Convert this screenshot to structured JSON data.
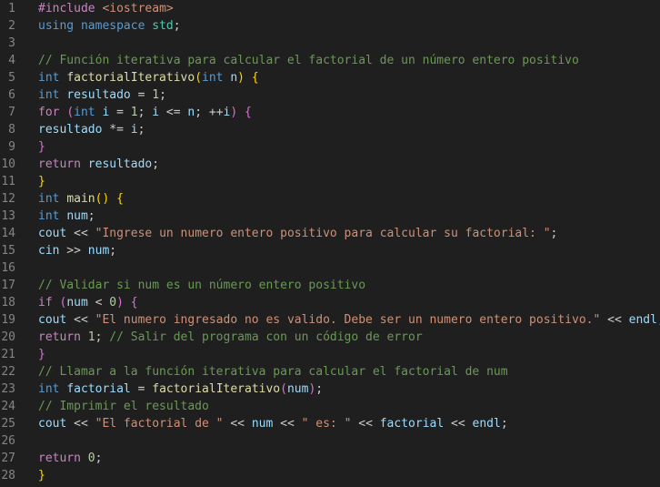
{
  "editor": {
    "language": "C++",
    "lines": [
      {
        "n": "1",
        "tokens": [
          {
            "t": "#include",
            "c": "c"
          },
          {
            "t": " ",
            "c": "p"
          },
          {
            "t": "<iostream>",
            "c": "inc"
          }
        ]
      },
      {
        "n": "2",
        "tokens": [
          {
            "t": "using",
            "c": "k"
          },
          {
            "t": " ",
            "c": "p"
          },
          {
            "t": "namespace",
            "c": "k"
          },
          {
            "t": " ",
            "c": "p"
          },
          {
            "t": "std",
            "c": "t"
          },
          {
            "t": ";",
            "c": "p"
          }
        ]
      },
      {
        "n": "3",
        "tokens": []
      },
      {
        "n": "4",
        "tokens": [
          {
            "t": "// Función iterativa para calcular el factorial de un número entero positivo",
            "c": "cm"
          }
        ]
      },
      {
        "n": "5",
        "tokens": [
          {
            "t": "int",
            "c": "k"
          },
          {
            "t": " ",
            "c": "p"
          },
          {
            "t": "factorialIterativo",
            "c": "f"
          },
          {
            "t": "(",
            "c": "b1"
          },
          {
            "t": "int",
            "c": "k"
          },
          {
            "t": " ",
            "c": "p"
          },
          {
            "t": "n",
            "c": "v"
          },
          {
            "t": ")",
            "c": "b1"
          },
          {
            "t": " ",
            "c": "p"
          },
          {
            "t": "{",
            "c": "b1"
          }
        ]
      },
      {
        "n": "6",
        "tokens": [
          {
            "t": "int",
            "c": "k"
          },
          {
            "t": " ",
            "c": "p"
          },
          {
            "t": "resultado",
            "c": "v"
          },
          {
            "t": " = ",
            "c": "p"
          },
          {
            "t": "1",
            "c": "n"
          },
          {
            "t": ";",
            "c": "p"
          }
        ]
      },
      {
        "n": "7",
        "tokens": [
          {
            "t": "for",
            "c": "c"
          },
          {
            "t": " ",
            "c": "p"
          },
          {
            "t": "(",
            "c": "b2"
          },
          {
            "t": "int",
            "c": "k"
          },
          {
            "t": " ",
            "c": "p"
          },
          {
            "t": "i",
            "c": "v"
          },
          {
            "t": " = ",
            "c": "p"
          },
          {
            "t": "1",
            "c": "n"
          },
          {
            "t": "; ",
            "c": "p"
          },
          {
            "t": "i",
            "c": "v"
          },
          {
            "t": " <= ",
            "c": "p"
          },
          {
            "t": "n",
            "c": "v"
          },
          {
            "t": "; ++",
            "c": "p"
          },
          {
            "t": "i",
            "c": "v"
          },
          {
            "t": ")",
            "c": "b2"
          },
          {
            "t": " ",
            "c": "p"
          },
          {
            "t": "{",
            "c": "b2"
          }
        ]
      },
      {
        "n": "8",
        "tokens": [
          {
            "t": "resultado",
            "c": "v"
          },
          {
            "t": " *= ",
            "c": "p"
          },
          {
            "t": "i",
            "c": "v"
          },
          {
            "t": ";",
            "c": "p"
          }
        ]
      },
      {
        "n": "9",
        "tokens": [
          {
            "t": "}",
            "c": "b2"
          }
        ]
      },
      {
        "n": "10",
        "tokens": [
          {
            "t": "return",
            "c": "c"
          },
          {
            "t": " ",
            "c": "p"
          },
          {
            "t": "resultado",
            "c": "v"
          },
          {
            "t": ";",
            "c": "p"
          }
        ]
      },
      {
        "n": "11",
        "tokens": [
          {
            "t": "}",
            "c": "b1"
          }
        ]
      },
      {
        "n": "12",
        "tokens": [
          {
            "t": "int",
            "c": "k"
          },
          {
            "t": " ",
            "c": "p"
          },
          {
            "t": "main",
            "c": "f"
          },
          {
            "t": "()",
            "c": "b1"
          },
          {
            "t": " ",
            "c": "p"
          },
          {
            "t": "{",
            "c": "b1"
          }
        ]
      },
      {
        "n": "13",
        "tokens": [
          {
            "t": "int",
            "c": "k"
          },
          {
            "t": " ",
            "c": "p"
          },
          {
            "t": "num",
            "c": "v"
          },
          {
            "t": ";",
            "c": "p"
          }
        ]
      },
      {
        "n": "14",
        "tokens": [
          {
            "t": "cout",
            "c": "v"
          },
          {
            "t": " << ",
            "c": "p"
          },
          {
            "t": "\"Ingrese un numero entero positivo para calcular su factorial: \"",
            "c": "s"
          },
          {
            "t": ";",
            "c": "p"
          }
        ]
      },
      {
        "n": "15",
        "tokens": [
          {
            "t": "cin",
            "c": "v"
          },
          {
            "t": " >> ",
            "c": "p"
          },
          {
            "t": "num",
            "c": "v"
          },
          {
            "t": ";",
            "c": "p"
          }
        ]
      },
      {
        "n": "16",
        "tokens": []
      },
      {
        "n": "17",
        "tokens": [
          {
            "t": "// Validar si num es un número entero positivo",
            "c": "cm"
          }
        ]
      },
      {
        "n": "18",
        "tokens": [
          {
            "t": "if",
            "c": "c"
          },
          {
            "t": " ",
            "c": "p"
          },
          {
            "t": "(",
            "c": "b2"
          },
          {
            "t": "num",
            "c": "v"
          },
          {
            "t": " < ",
            "c": "p"
          },
          {
            "t": "0",
            "c": "n"
          },
          {
            "t": ")",
            "c": "b2"
          },
          {
            "t": " ",
            "c": "p"
          },
          {
            "t": "{",
            "c": "b2"
          }
        ]
      },
      {
        "n": "19",
        "tokens": [
          {
            "t": "cout",
            "c": "v"
          },
          {
            "t": " << ",
            "c": "p"
          },
          {
            "t": "\"El numero ingresado no es valido. Debe ser un numero entero positivo.\"",
            "c": "s"
          },
          {
            "t": " << ",
            "c": "p"
          },
          {
            "t": "endl",
            "c": "v"
          },
          {
            "t": ";",
            "c": "p"
          }
        ]
      },
      {
        "n": "20",
        "tokens": [
          {
            "t": "return",
            "c": "c"
          },
          {
            "t": " ",
            "c": "p"
          },
          {
            "t": "1",
            "c": "n"
          },
          {
            "t": "; ",
            "c": "p"
          },
          {
            "t": "// Salir del programa con un código de error",
            "c": "cm"
          }
        ]
      },
      {
        "n": "21",
        "tokens": [
          {
            "t": "}",
            "c": "b2"
          }
        ]
      },
      {
        "n": "22",
        "tokens": [
          {
            "t": "// Llamar a la función iterativa para calcular el factorial de num",
            "c": "cm"
          }
        ]
      },
      {
        "n": "23",
        "tokens": [
          {
            "t": "int",
            "c": "k"
          },
          {
            "t": " ",
            "c": "p"
          },
          {
            "t": "factorial",
            "c": "v"
          },
          {
            "t": " = ",
            "c": "p"
          },
          {
            "t": "factorialIterativo",
            "c": "f"
          },
          {
            "t": "(",
            "c": "b2"
          },
          {
            "t": "num",
            "c": "v"
          },
          {
            "t": ")",
            "c": "b2"
          },
          {
            "t": ";",
            "c": "p"
          }
        ]
      },
      {
        "n": "24",
        "tokens": [
          {
            "t": "// Imprimir el resultado",
            "c": "cm"
          }
        ]
      },
      {
        "n": "25",
        "tokens": [
          {
            "t": "cout",
            "c": "v"
          },
          {
            "t": " << ",
            "c": "p"
          },
          {
            "t": "\"El factorial de \"",
            "c": "s"
          },
          {
            "t": " << ",
            "c": "p"
          },
          {
            "t": "num",
            "c": "v"
          },
          {
            "t": " << ",
            "c": "p"
          },
          {
            "t": "\" es: \"",
            "c": "s"
          },
          {
            "t": " << ",
            "c": "p"
          },
          {
            "t": "factorial",
            "c": "v"
          },
          {
            "t": " << ",
            "c": "p"
          },
          {
            "t": "endl",
            "c": "v"
          },
          {
            "t": ";",
            "c": "p"
          }
        ]
      },
      {
        "n": "26",
        "tokens": []
      },
      {
        "n": "27",
        "tokens": [
          {
            "t": "return",
            "c": "c"
          },
          {
            "t": " ",
            "c": "p"
          },
          {
            "t": "0",
            "c": "n"
          },
          {
            "t": ";",
            "c": "p"
          }
        ]
      },
      {
        "n": "28",
        "tokens": [
          {
            "t": "}",
            "c": "b1"
          }
        ]
      }
    ]
  }
}
